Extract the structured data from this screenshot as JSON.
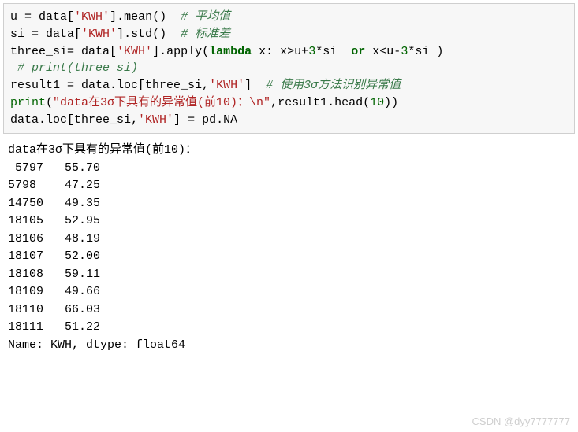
{
  "code": {
    "line1": {
      "a": "u ",
      "op1": "=",
      "b": " data[",
      "s1": "'KWH'",
      "c": "].",
      "fn": "mean",
      "d": "()  ",
      "cm": "# 平均值"
    },
    "line2": {
      "a": "si ",
      "op1": "=",
      "b": " data[",
      "s1": "'KWH'",
      "c": "].",
      "fn": "std",
      "d": "()  ",
      "cm": "# 标准差"
    },
    "line3": {
      "a": "three_si",
      "op1": "=",
      "b": " data[",
      "s1": "'KWH'",
      "c": "].",
      "fn": "apply",
      "d": "(",
      "kw1": "lambda",
      "e": " x: x",
      "op2": ">",
      "f": "u",
      "op3": "+",
      "n1": "3",
      "op4": "*",
      "g": "si  ",
      "kw2": "or",
      "h": " x",
      "op5": "<",
      "i": "u",
      "op6": "-",
      "n2": "3",
      "op7": "*",
      "j": "si )"
    },
    "line4": {
      "cm": " # print(three_si)"
    },
    "line5": {
      "a": "result1 ",
      "op1": "=",
      "b": " data.loc[three_si,",
      "s1": "'KWH'",
      "c": "]  ",
      "cm": "# 使用3σ方法识别异常值"
    },
    "line6": {
      "fn": "print",
      "a": "(",
      "s1": "\"data在3σ下具有的异常值(前10)：\\n\"",
      "b": ",result1.head(",
      "n1": "10",
      "c": "))"
    },
    "line7": {
      "a": "data.loc[three_si,",
      "s1": "'KWH'",
      "b": "] ",
      "op1": "=",
      "c": " pd.NA"
    }
  },
  "output": {
    "header": "data在3σ下具有的异常值(前10)：",
    "rows": [
      {
        "idx": " 5797",
        "val": "   55.70"
      },
      {
        "idx": "5798",
        "val": "    47.25"
      },
      {
        "idx": "14750",
        "val": "   49.35"
      },
      {
        "idx": "18105",
        "val": "   52.95"
      },
      {
        "idx": "18106",
        "val": "   48.19"
      },
      {
        "idx": "18107",
        "val": "   52.00"
      },
      {
        "idx": "18108",
        "val": "   59.11"
      },
      {
        "idx": "18109",
        "val": "   49.66"
      },
      {
        "idx": "18110",
        "val": "   66.03"
      },
      {
        "idx": "18111",
        "val": "   51.22"
      }
    ],
    "footer": "Name: KWH, dtype: float64"
  },
  "watermark": "CSDN @dyy7777777"
}
